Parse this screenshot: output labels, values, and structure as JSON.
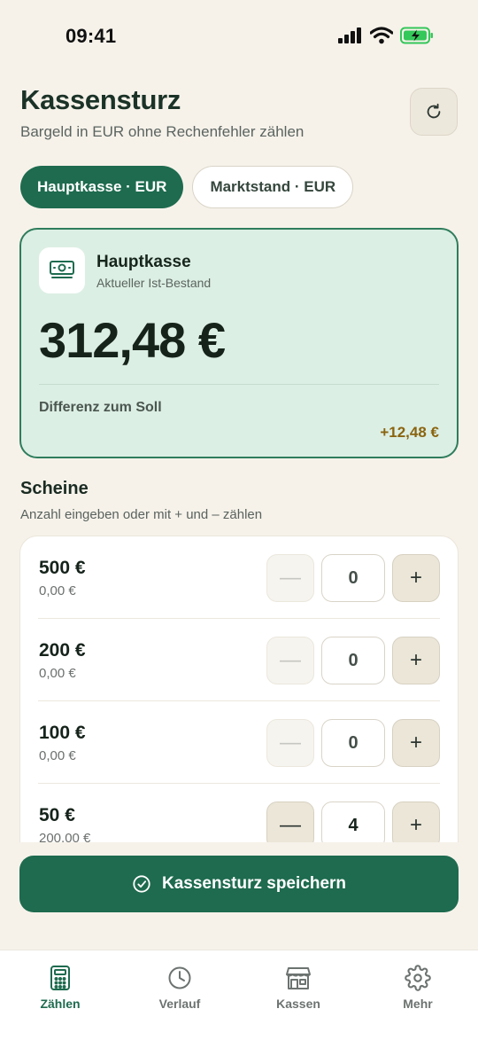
{
  "status_bar": {
    "time": "09:41"
  },
  "header": {
    "title": "Kassensturz",
    "subtitle": "Bargeld in EUR ohne Rechenfehler zählen",
    "refresh_icon": "refresh-icon"
  },
  "tabs": [
    {
      "label": "Hauptkasse · EUR",
      "active": true
    },
    {
      "label": "Marktstand · EUR",
      "active": false
    }
  ],
  "summary": {
    "title": "Hauptkasse",
    "subtitle": "Aktueller Ist-Bestand",
    "amount": "312,48 €",
    "diff_label": "Differenz zum Soll",
    "diff_value": "+12,48 €"
  },
  "section": {
    "title": "Scheine",
    "subtitle": "Anzahl eingeben oder mit + und – zählen"
  },
  "denominations": [
    {
      "label": "500 €",
      "subtotal": "0,00 €",
      "count": "0",
      "minus_enabled": false
    },
    {
      "label": "200 €",
      "subtotal": "0,00 €",
      "count": "0",
      "minus_enabled": false
    },
    {
      "label": "100 €",
      "subtotal": "0,00 €",
      "count": "0",
      "minus_enabled": false
    },
    {
      "label": "50 €",
      "subtotal": "200,00 €",
      "count": "4",
      "minus_enabled": true
    }
  ],
  "save_button": {
    "label": "Kassensturz speichern"
  },
  "nav": [
    {
      "label": "Zählen",
      "icon": "calculator-icon",
      "active": true
    },
    {
      "label": "Verlauf",
      "icon": "clock-icon",
      "active": false
    },
    {
      "label": "Kassen",
      "icon": "store-icon",
      "active": false
    },
    {
      "label": "Mehr",
      "icon": "gear-icon",
      "active": false
    }
  ],
  "colors": {
    "accent": "#1e6b4f",
    "background": "#f6f2ea",
    "summary_bg": "#dcefe4",
    "diff_color": "#8a6410"
  }
}
